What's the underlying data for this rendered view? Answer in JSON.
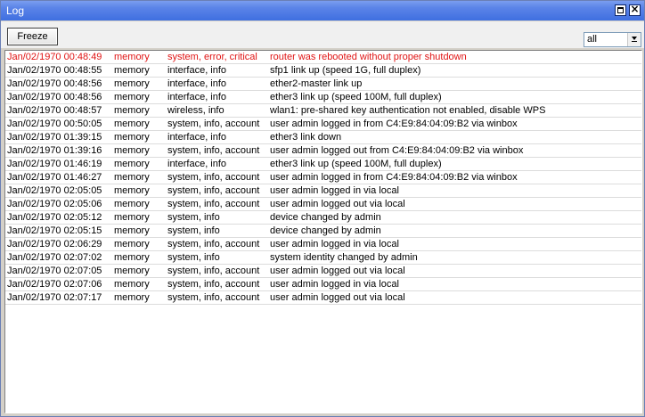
{
  "window": {
    "title": "Log"
  },
  "toolbar": {
    "freeze_label": "Freeze",
    "filter_value": "all"
  },
  "log": {
    "rows": [
      {
        "time": "Jan/02/1970 00:48:49",
        "buffer": "memory",
        "topics": "system, error, critical",
        "message": "router was rebooted without proper shutdown",
        "level": "error"
      },
      {
        "time": "Jan/02/1970 00:48:55",
        "buffer": "memory",
        "topics": "interface, info",
        "message": "sfp1 link up (speed 1G, full duplex)",
        "level": "info"
      },
      {
        "time": "Jan/02/1970 00:48:56",
        "buffer": "memory",
        "topics": "interface, info",
        "message": "ether2-master link up",
        "level": "info"
      },
      {
        "time": "Jan/02/1970 00:48:56",
        "buffer": "memory",
        "topics": "interface, info",
        "message": "ether3 link up (speed 100M, full duplex)",
        "level": "info"
      },
      {
        "time": "Jan/02/1970 00:48:57",
        "buffer": "memory",
        "topics": "wireless, info",
        "message": "wlan1: pre-shared key authentication not enabled, disable WPS",
        "level": "info"
      },
      {
        "time": "Jan/02/1970 00:50:05",
        "buffer": "memory",
        "topics": "system, info, account",
        "message": "user admin logged in from C4:E9:84:04:09:B2 via winbox",
        "level": "info"
      },
      {
        "time": "Jan/02/1970 01:39:15",
        "buffer": "memory",
        "topics": "interface, info",
        "message": "ether3 link down",
        "level": "info"
      },
      {
        "time": "Jan/02/1970 01:39:16",
        "buffer": "memory",
        "topics": "system, info, account",
        "message": "user admin logged out from C4:E9:84:04:09:B2 via winbox",
        "level": "info"
      },
      {
        "time": "Jan/02/1970 01:46:19",
        "buffer": "memory",
        "topics": "interface, info",
        "message": "ether3 link up (speed 100M, full duplex)",
        "level": "info"
      },
      {
        "time": "Jan/02/1970 01:46:27",
        "buffer": "memory",
        "topics": "system, info, account",
        "message": "user admin logged in from C4:E9:84:04:09:B2 via winbox",
        "level": "info"
      },
      {
        "time": "Jan/02/1970 02:05:05",
        "buffer": "memory",
        "topics": "system, info, account",
        "message": "user admin logged in via local",
        "level": "info"
      },
      {
        "time": "Jan/02/1970 02:05:06",
        "buffer": "memory",
        "topics": "system, info, account",
        "message": "user admin logged out via local",
        "level": "info"
      },
      {
        "time": "Jan/02/1970 02:05:12",
        "buffer": "memory",
        "topics": "system, info",
        "message": "device changed by admin",
        "level": "info"
      },
      {
        "time": "Jan/02/1970 02:05:15",
        "buffer": "memory",
        "topics": "system, info",
        "message": "device changed by admin",
        "level": "info"
      },
      {
        "time": "Jan/02/1970 02:06:29",
        "buffer": "memory",
        "topics": "system, info, account",
        "message": "user admin logged in via local",
        "level": "info"
      },
      {
        "time": "Jan/02/1970 02:07:02",
        "buffer": "memory",
        "topics": "system, info",
        "message": "system identity changed by admin",
        "level": "info"
      },
      {
        "time": "Jan/02/1970 02:07:05",
        "buffer": "memory",
        "topics": "system, info, account",
        "message": "user admin logged out via local",
        "level": "info"
      },
      {
        "time": "Jan/02/1970 02:07:06",
        "buffer": "memory",
        "topics": "system, info, account",
        "message": "user admin logged in via local",
        "level": "info"
      },
      {
        "time": "Jan/02/1970 02:07:17",
        "buffer": "memory",
        "topics": "system, info, account",
        "message": "user admin logged out via local",
        "level": "info"
      }
    ]
  },
  "colors": {
    "error_text": "#e01414",
    "titlebar": "#3f6fe0"
  },
  "icons": {
    "restore": "restore-icon",
    "close": "close-icon",
    "dropdown": "dropdown-arrow-icon"
  }
}
